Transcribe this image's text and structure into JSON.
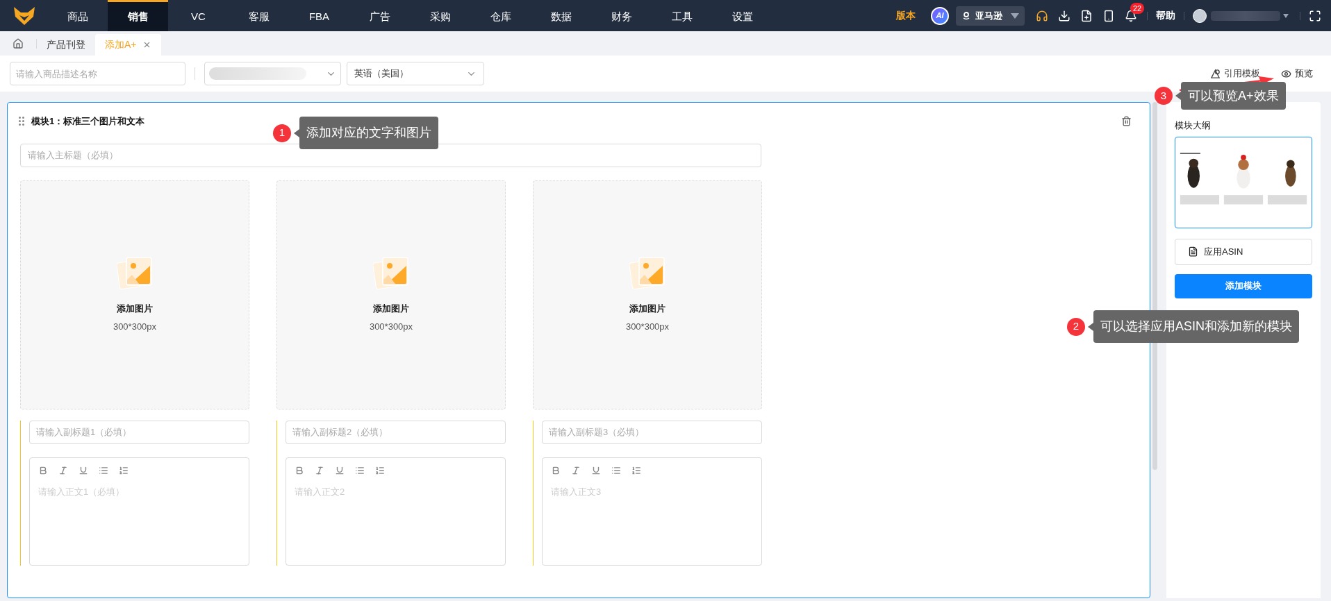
{
  "nav": {
    "items": [
      {
        "label": "商品",
        "selected": false
      },
      {
        "label": "销售",
        "selected": true
      },
      {
        "label": "VC",
        "selected": false
      },
      {
        "label": "客服",
        "selected": false
      },
      {
        "label": "FBA",
        "selected": false
      },
      {
        "label": "广告",
        "selected": false
      },
      {
        "label": "采购",
        "selected": false
      },
      {
        "label": "仓库",
        "selected": false
      },
      {
        "label": "数据",
        "selected": false
      },
      {
        "label": "财务",
        "selected": false
      },
      {
        "label": "工具",
        "selected": false
      },
      {
        "label": "设置",
        "selected": false
      }
    ],
    "edition": "版本",
    "ai": "AI",
    "marketplace": "亚马逊",
    "notifications": "22",
    "help": "帮助"
  },
  "tabs": [
    {
      "label": "产品刊登",
      "selected": false,
      "closable": false
    },
    {
      "label": "添加A+",
      "selected": true,
      "closable": true
    }
  ],
  "toolbar": {
    "name_placeholder": "请输入商品描述名称",
    "language": "英语（美国）",
    "template": "引用模板",
    "preview": "预览"
  },
  "module": {
    "title": "模块1：标准三个图片和文本",
    "headline_placeholder": "请输入主标题（必填）",
    "columns": [
      {
        "image_label": "添加图片",
        "image_size": "300*300px",
        "subtitle_placeholder": "请输入副标题1（必填）",
        "body_placeholder": "请输入正文1（必填）"
      },
      {
        "image_label": "添加图片",
        "image_size": "300*300px",
        "subtitle_placeholder": "请输入副标题2（必填）",
        "body_placeholder": "请输入正文2"
      },
      {
        "image_label": "添加图片",
        "image_size": "300*300px",
        "subtitle_placeholder": "请输入副标题3（必填）",
        "body_placeholder": "请输入正文3"
      }
    ]
  },
  "outline": {
    "title": "模块大纲",
    "apply_asin": "应用ASIN",
    "add_module": "添加模块"
  },
  "callouts": [
    {
      "number": "3",
      "text": "可以预览A+效果"
    },
    {
      "number": "1",
      "text": "添加对应的文字和图片"
    },
    {
      "number": "2",
      "text": "可以选择应用ASIN和添加新的模块"
    }
  ]
}
